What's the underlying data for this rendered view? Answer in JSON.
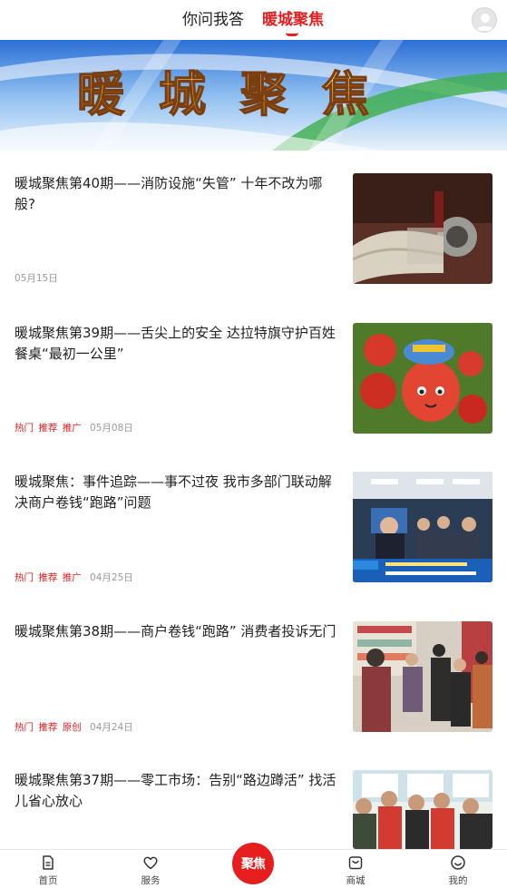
{
  "header": {
    "tabs": [
      {
        "label": "你问我答"
      },
      {
        "label": "暖城聚焦"
      }
    ]
  },
  "banner": {
    "title_text": "暖城聚焦"
  },
  "articles": [
    {
      "title": "暖城聚焦第40期——消防设施“失管” 十年不改为哪般?",
      "tags": [],
      "date": "05月15日"
    },
    {
      "title": "暖城聚焦第39期——舌尖上的安全 达拉特旗守护百姓餐桌“最初一公里”",
      "tags": [
        "热门",
        "推荐",
        "推广"
      ],
      "date": "05月08日"
    },
    {
      "title": "暖城聚焦：事件追踪——事不过夜 我市多部门联动解决商户卷钱“跑路”问题",
      "tags": [
        "热门",
        "推荐",
        "推广"
      ],
      "date": "04月25日"
    },
    {
      "title": "暖城聚焦第38期——商户卷钱“跑路” 消费者投诉无门",
      "tags": [
        "热门",
        "推荐",
        "原创"
      ],
      "date": "04月24日"
    },
    {
      "title": "暖城聚焦第37期——零工市场：告别“路边蹲活” 找活儿省心放心",
      "tags": [],
      "date": ""
    }
  ],
  "bottom_nav": {
    "items": [
      {
        "label": "首页",
        "icon": "home-doc-icon"
      },
      {
        "label": "服务",
        "icon": "heart-icon"
      },
      {
        "label": "聚焦",
        "icon": "focus-logo"
      },
      {
        "label": "商城",
        "icon": "shop-bag-icon"
      },
      {
        "label": "我的",
        "icon": "smiley-icon"
      }
    ]
  },
  "colors": {
    "accent": "#e61e1e",
    "text": "#222222",
    "muted": "#999999"
  }
}
